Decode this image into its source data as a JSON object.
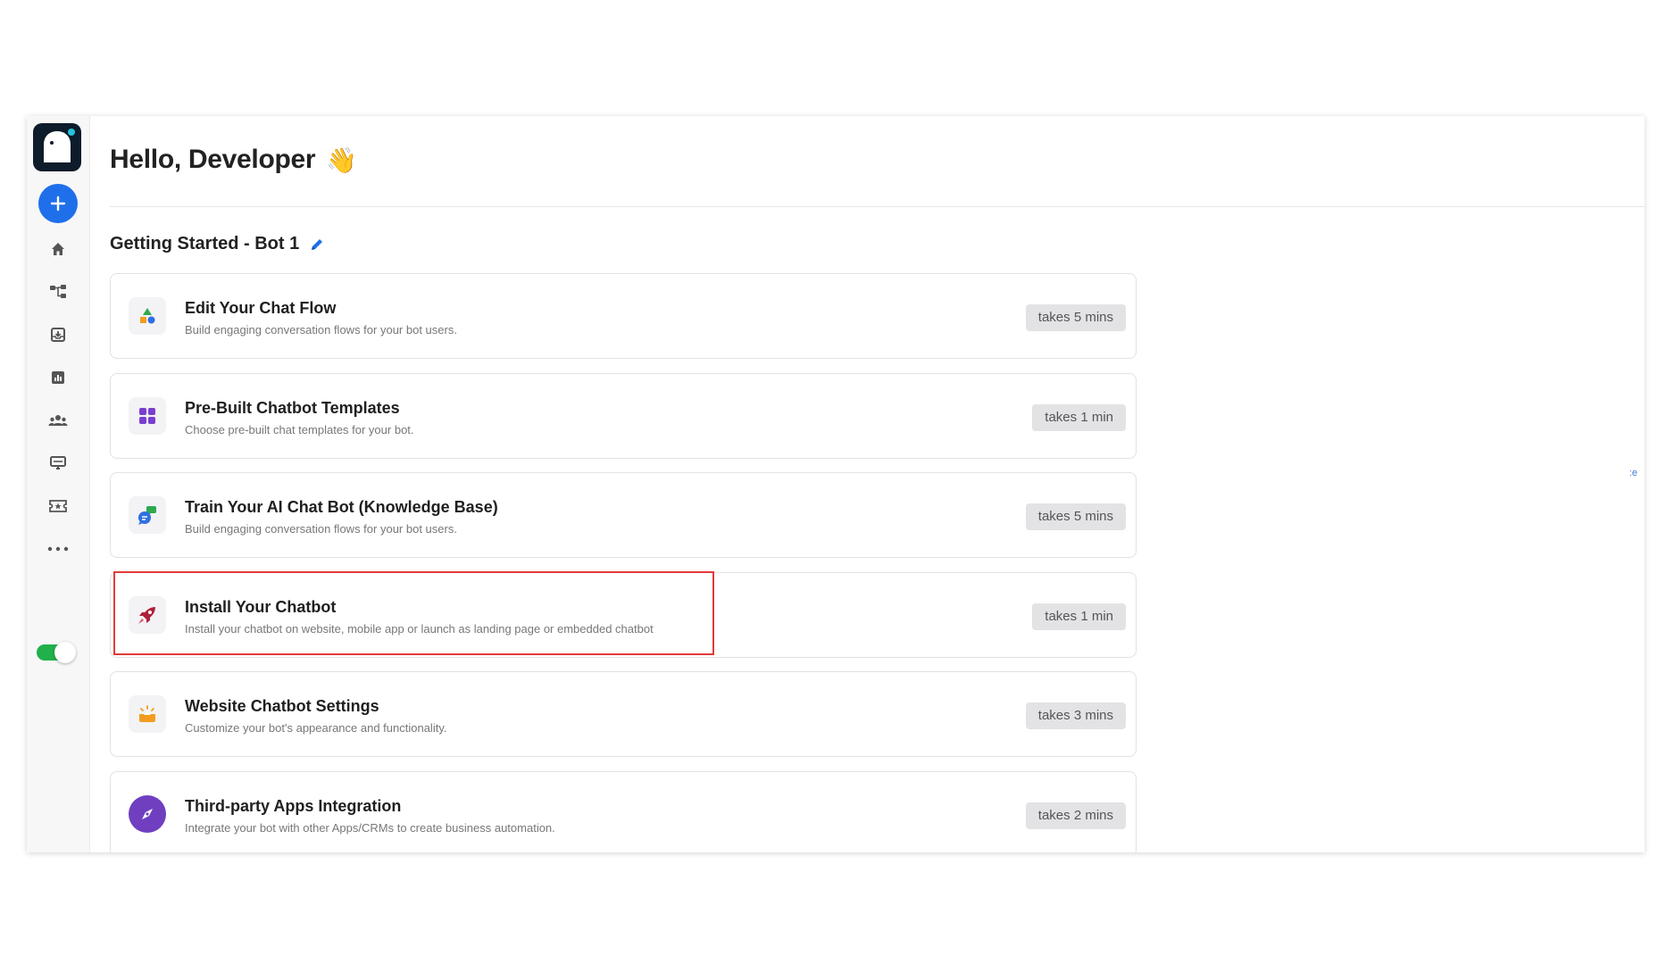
{
  "header": {
    "greeting": "Hello, Developer",
    "wave_emoji": "👋"
  },
  "section": {
    "title": "Getting Started - Bot 1"
  },
  "sidebar": {
    "logo_icon": "ghost-logo-icon",
    "add_icon": "plus-icon",
    "items": [
      {
        "name": "home",
        "icon": "home-icon"
      },
      {
        "name": "flow",
        "icon": "flow-icon"
      },
      {
        "name": "inbox",
        "icon": "inbox-icon"
      },
      {
        "name": "analytics",
        "icon": "bar-chart-icon"
      },
      {
        "name": "users",
        "icon": "users-icon"
      },
      {
        "name": "monitor",
        "icon": "monitor-icon"
      },
      {
        "name": "tickets",
        "icon": "ticket-icon"
      },
      {
        "name": "more",
        "icon": "more-dots-icon"
      }
    ],
    "toggle_on": true
  },
  "tasks": [
    {
      "title": "Edit Your Chat Flow",
      "desc": "Build engaging conversation flows for your bot users.",
      "time": "takes 5 mins",
      "icon": "shapes-icon"
    },
    {
      "title": "Pre-Built Chatbot Templates",
      "desc": "Choose pre-built chat templates for your bot.",
      "time": "takes 1 min",
      "icon": "grid-icon"
    },
    {
      "title": "Train Your AI Chat Bot (Knowledge Base)",
      "desc": "Build engaging conversation flows for your bot users.",
      "time": "takes 5 mins",
      "icon": "chat-bubbles-icon"
    },
    {
      "title": "Install Your Chatbot",
      "desc": "Install your chatbot on website, mobile app or launch as landing page or embedded chatbot",
      "time": "takes 1 min",
      "icon": "rocket-icon"
    },
    {
      "title": "Website Chatbot Settings",
      "desc": "Customize your bot's appearance and functionality.",
      "time": "takes 3 mins",
      "icon": "sparkle-tray-icon"
    },
    {
      "title": "Third-party Apps Integration",
      "desc": "Integrate your bot with other Apps/CRMs to create business automation.",
      "time": "takes 2 mins",
      "icon": "compass-icon"
    }
  ],
  "edge_text": ":e",
  "colors": {
    "accent": "#1f6feb",
    "highlight": "#e23b3b",
    "toggle": "#22b04b",
    "badge_bg": "#e3e3e6"
  }
}
